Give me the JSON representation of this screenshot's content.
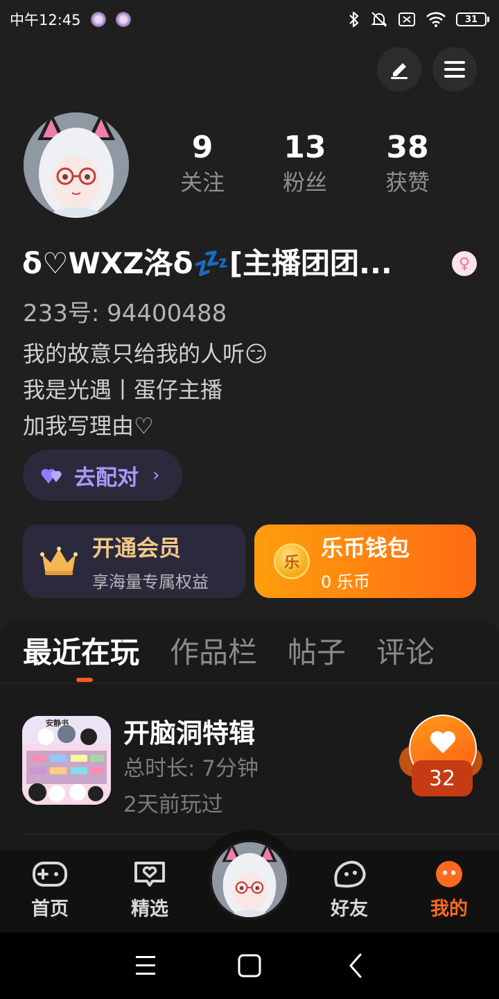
{
  "status_bar": {
    "time": "中午12:45",
    "battery": "31"
  },
  "header": {
    "edit_icon": "pencil-icon",
    "menu_icon": "hamburger-menu-icon"
  },
  "profile": {
    "stats": [
      {
        "value": "9",
        "label": "关注"
      },
      {
        "value": "13",
        "label": "粉丝"
      },
      {
        "value": "38",
        "label": "获赞"
      }
    ],
    "nickname": "δ♡WXZ洛δ💤[主播团团...",
    "gender_symbol": "♀",
    "id_label": "233号: 94400488",
    "bio": [
      "我的故意只给我的人听😏",
      "我是光遇丨蛋仔主播",
      "加我写理由♡"
    ],
    "match_button": "去配对"
  },
  "cards": {
    "vip": {
      "title": "开通会员",
      "subtitle": "享海量专属权益"
    },
    "wallet": {
      "title": "乐币钱包",
      "subtitle": "0 乐币",
      "coin_glyph": "乐"
    }
  },
  "tabs": [
    {
      "label": "最近在玩",
      "active": true
    },
    {
      "label": "作品栏",
      "active": false
    },
    {
      "label": "帖子",
      "active": false
    },
    {
      "label": "评论",
      "active": false
    }
  ],
  "recent_games": [
    {
      "title": "开脑洞特辑",
      "duration": "总时长: 7分钟",
      "last_played": "2天前玩过",
      "likes": "32",
      "icon_text": "安静书"
    }
  ],
  "bottom_nav": [
    {
      "label": "首页",
      "icon": "gamepad-icon"
    },
    {
      "label": "精选",
      "icon": "heart-chat-icon"
    },
    {
      "label": "好友",
      "icon": "friend-face-icon"
    },
    {
      "label": "我的",
      "icon": "profile-face-icon",
      "active": true
    }
  ],
  "colors": {
    "accent": "#ff6a1f",
    "vip_text": "#f3c88a",
    "match_text": "#a69aff"
  }
}
